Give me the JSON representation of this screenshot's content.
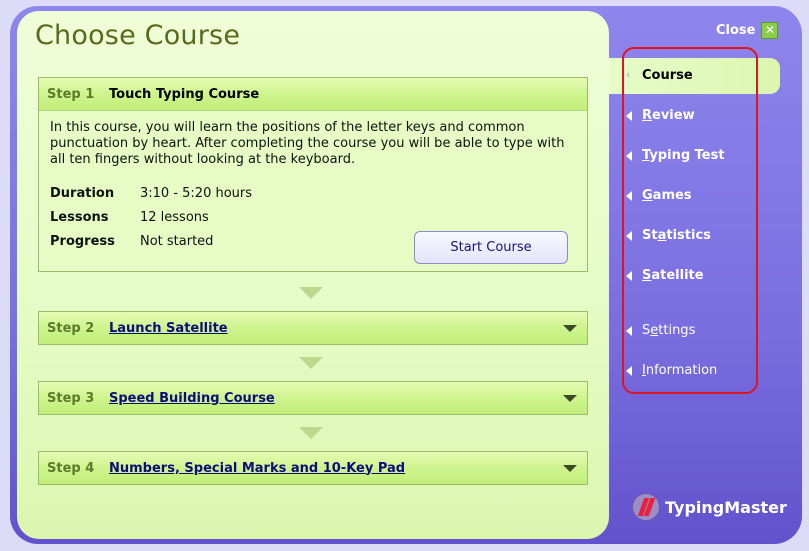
{
  "page": {
    "title": "Choose Course"
  },
  "close": {
    "label": "Close",
    "icon": "close-x-icon"
  },
  "steps": [
    {
      "num": "Step 1",
      "name": "Touch Typing Course",
      "expanded": true,
      "description": "In this course, you will learn the positions of the letter keys and common punctuation by heart. After completing the course you will be able to type with all ten fingers without looking at the keyboard.",
      "info": [
        {
          "label": "Duration",
          "value": "3:10 - 5:20 hours"
        },
        {
          "label": "Lessons",
          "value": "12 lessons"
        },
        {
          "label": "Progress",
          "value": "Not started"
        }
      ],
      "button": "Start Course"
    },
    {
      "num": "Step 2",
      "name": "Launch Satellite",
      "expanded": false
    },
    {
      "num": "Step 3",
      "name": "Speed Building Course",
      "expanded": false
    },
    {
      "num": "Step 4",
      "name": "Numbers, Special Marks and 10-Key Pad",
      "expanded": false
    }
  ],
  "nav": {
    "active": "Course",
    "items": [
      {
        "label": "Review",
        "mnemonic": "R"
      },
      {
        "label": "Typing Test",
        "mnemonic": "T"
      },
      {
        "label": "Games",
        "mnemonic": "G"
      },
      {
        "label": "Statistics",
        "mnemonic": "a"
      },
      {
        "label": "Satellite",
        "mnemonic": "S"
      },
      {
        "label": "Settings",
        "mnemonic": "e"
      },
      {
        "label": "Information",
        "mnemonic": "I"
      }
    ]
  },
  "brand": {
    "name": "TypingMaster"
  },
  "colors": {
    "sidebar": "#8f86ec",
    "panel": "#e6fcc8",
    "link": "#0c0c7a",
    "highlight": "#e0141e"
  }
}
